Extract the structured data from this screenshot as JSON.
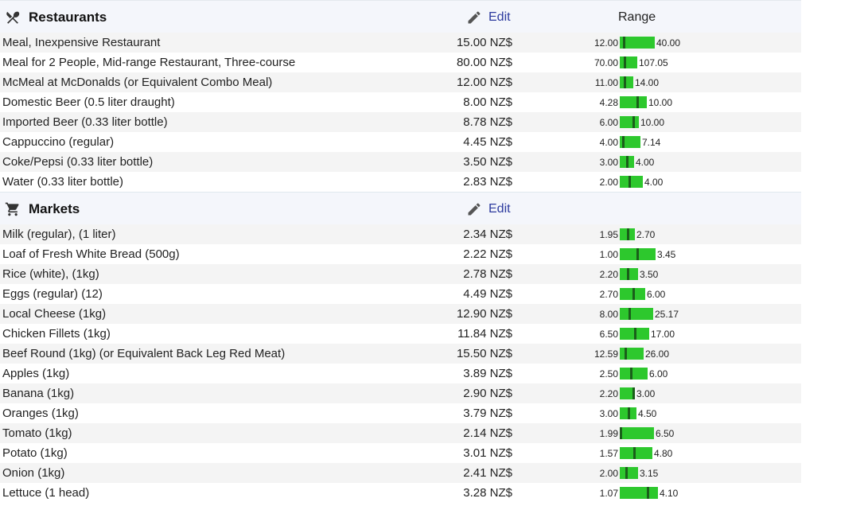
{
  "restaurants": {
    "title": "Restaurants",
    "edit_label": "Edit",
    "range_header": "Range",
    "icon": "fork-knife-icon",
    "items": [
      {
        "name": "Meal, Inexpensive Restaurant",
        "price": "15.00 NZ$",
        "min": "12.00",
        "max": "40.00",
        "min_v": 12,
        "max_v": 40,
        "price_v": 15
      },
      {
        "name": "Meal for 2 People, Mid-range Restaurant, Three-course",
        "price": "80.00 NZ$",
        "min": "70.00",
        "max": "107.05",
        "min_v": 70,
        "max_v": 107.05,
        "price_v": 80
      },
      {
        "name": "McMeal at McDonalds (or Equivalent Combo Meal)",
        "price": "12.00 NZ$",
        "min": "11.00",
        "max": "14.00",
        "min_v": 11,
        "max_v": 14,
        "price_v": 12
      },
      {
        "name": "Domestic Beer (0.5 liter draught)",
        "price": "8.00 NZ$",
        "min": "4.28",
        "max": "10.00",
        "min_v": 4.28,
        "max_v": 10,
        "price_v": 8
      },
      {
        "name": "Imported Beer (0.33 liter bottle)",
        "price": "8.78 NZ$",
        "min": "6.00",
        "max": "10.00",
        "min_v": 6,
        "max_v": 10,
        "price_v": 8.78
      },
      {
        "name": "Cappuccino (regular)",
        "price": "4.45 NZ$",
        "min": "4.00",
        "max": "7.14",
        "min_v": 4,
        "max_v": 7.14,
        "price_v": 4.45
      },
      {
        "name": "Coke/Pepsi (0.33 liter bottle)",
        "price": "3.50 NZ$",
        "min": "3.00",
        "max": "4.00",
        "min_v": 3,
        "max_v": 4,
        "price_v": 3.5
      },
      {
        "name": "Water (0.33 liter bottle)",
        "price": "2.83 NZ$",
        "min": "2.00",
        "max": "4.00",
        "min_v": 2,
        "max_v": 4,
        "price_v": 2.83
      }
    ]
  },
  "markets": {
    "title": "Markets",
    "edit_label": "Edit",
    "icon": "shopping-cart-icon",
    "items": [
      {
        "name": "Milk (regular), (1 liter)",
        "price": "2.34 NZ$",
        "min": "1.95",
        "max": "2.70",
        "min_v": 1.95,
        "max_v": 2.7,
        "price_v": 2.34
      },
      {
        "name": "Loaf of Fresh White Bread (500g)",
        "price": "2.22 NZ$",
        "min": "1.00",
        "max": "3.45",
        "min_v": 1,
        "max_v": 3.45,
        "price_v": 2.22
      },
      {
        "name": "Rice (white), (1kg)",
        "price": "2.78 NZ$",
        "min": "2.20",
        "max": "3.50",
        "min_v": 2.2,
        "max_v": 3.5,
        "price_v": 2.78
      },
      {
        "name": "Eggs (regular) (12)",
        "price": "4.49 NZ$",
        "min": "2.70",
        "max": "6.00",
        "min_v": 2.7,
        "max_v": 6,
        "price_v": 4.49
      },
      {
        "name": "Local Cheese (1kg)",
        "price": "12.90 NZ$",
        "min": "8.00",
        "max": "25.17",
        "min_v": 8,
        "max_v": 25.17,
        "price_v": 12.9
      },
      {
        "name": "Chicken Fillets (1kg)",
        "price": "11.84 NZ$",
        "min": "6.50",
        "max": "17.00",
        "min_v": 6.5,
        "max_v": 17,
        "price_v": 11.84
      },
      {
        "name": "Beef Round (1kg) (or Equivalent Back Leg Red Meat)",
        "price": "15.50 NZ$",
        "min": "12.59",
        "max": "26.00",
        "min_v": 12.59,
        "max_v": 26,
        "price_v": 15.5
      },
      {
        "name": "Apples (1kg)",
        "price": "3.89 NZ$",
        "min": "2.50",
        "max": "6.00",
        "min_v": 2.5,
        "max_v": 6,
        "price_v": 3.89
      },
      {
        "name": "Banana (1kg)",
        "price": "2.90 NZ$",
        "min": "2.20",
        "max": "3.00",
        "min_v": 2.2,
        "max_v": 3,
        "price_v": 2.9
      },
      {
        "name": "Oranges (1kg)",
        "price": "3.79 NZ$",
        "min": "3.00",
        "max": "4.50",
        "min_v": 3,
        "max_v": 4.5,
        "price_v": 3.79
      },
      {
        "name": "Tomato (1kg)",
        "price": "2.14 NZ$",
        "min": "1.99",
        "max": "6.50",
        "min_v": 1.99,
        "max_v": 6.5,
        "price_v": 2.14
      },
      {
        "name": "Potato (1kg)",
        "price": "3.01 NZ$",
        "min": "1.57",
        "max": "4.80",
        "min_v": 1.57,
        "max_v": 4.8,
        "price_v": 3.01
      },
      {
        "name": "Onion (1kg)",
        "price": "2.41 NZ$",
        "min": "2.00",
        "max": "3.15",
        "min_v": 2,
        "max_v": 3.15,
        "price_v": 2.41
      },
      {
        "name": "Lettuce (1 head)",
        "price": "3.28 NZ$",
        "min": "1.07",
        "max": "4.10",
        "min_v": 1.07,
        "max_v": 4.1,
        "price_v": 3.28
      }
    ]
  },
  "colors": {
    "bar": "#2dc82d",
    "marker": "#1a5e1a",
    "link": "#2c3a9e",
    "row_alt": "#f4f4f4",
    "header_bg": "#f4f6fb"
  }
}
